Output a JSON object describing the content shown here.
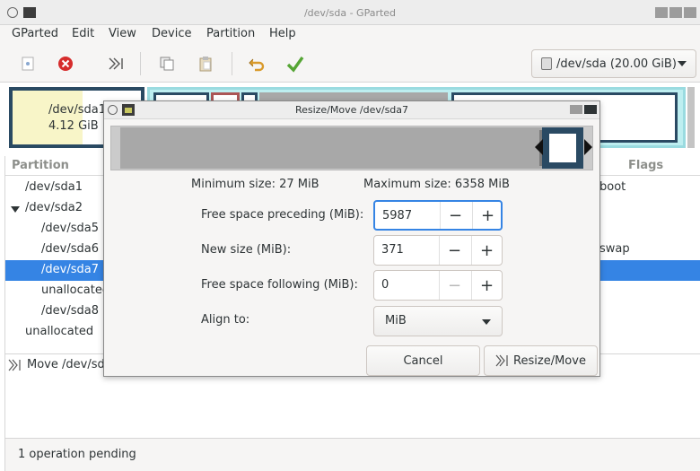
{
  "window": {
    "title": "/dev/sda - GParted"
  },
  "menu": [
    "GParted",
    "Edit",
    "View",
    "Device",
    "Partition",
    "Help"
  ],
  "toolbar": {
    "device_combo": "/dev/sda (20.00 GiB)",
    "tools": [
      "new-icon",
      "delete-icon",
      "resize-move-icon",
      "copy-icon",
      "paste-icon",
      "undo-icon",
      "apply-icon"
    ]
  },
  "graphic": {
    "p1_name": "/dev/sda1",
    "p1_size": "4.12 GiB"
  },
  "tree": {
    "columns": {
      "partition": "Partition",
      "flags": "Flags"
    },
    "rows": [
      {
        "name": "/dev/sda1",
        "flags": "boot"
      },
      {
        "name": "/dev/sda2",
        "flags": ""
      },
      {
        "name": "/dev/sda5",
        "flags": ""
      },
      {
        "name": "/dev/sda6",
        "flags": "swap"
      },
      {
        "name": "/dev/sda7",
        "flags": ""
      },
      {
        "name": "unallocated",
        "flags": ""
      },
      {
        "name": "/dev/sda8",
        "flags": ""
      },
      {
        "name": "unallocated",
        "flags": ""
      }
    ]
  },
  "operations": {
    "item": "Move /dev/sd"
  },
  "status": {
    "text": "1 operation pending"
  },
  "dialog": {
    "title": "Resize/Move /dev/sda7",
    "min_size": "Minimum size: 27 MiB",
    "max_size": "Maximum size: 6358 MiB",
    "fields": {
      "preceding_label": "Free space preceding (MiB):",
      "preceding_value": "5987",
      "new_size_label": "New size (MiB):",
      "new_size_value": "371",
      "following_label": "Free space following (MiB):",
      "following_value": "0",
      "align_label": "Align to:",
      "align_value": "MiB"
    },
    "spin_minus": "−",
    "spin_plus": "+",
    "cancel": "Cancel",
    "resize_move": "Resize/Move"
  }
}
